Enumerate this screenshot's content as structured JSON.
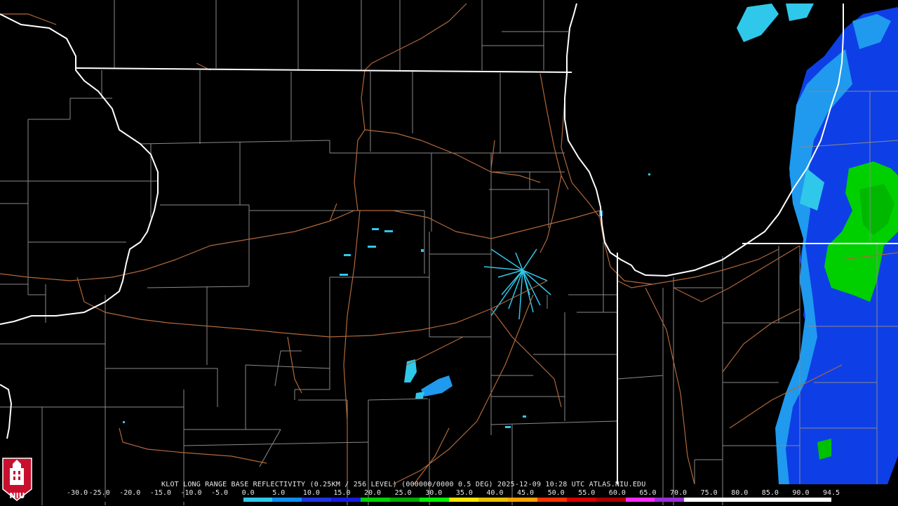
{
  "product_title": "KLOT LONG RANGE BASE REFLECTIVITY (0.25KM / 256 LEVEL) (000000/0000 0.5 DEG) 2025-12-09 10:28 UTC  ATLAS.NIU.EDU",
  "scale_labels": [
    "-30.0",
    "-25.0",
    "-20.0",
    "-15.0",
    "-10.0",
    "-5.0",
    "0.0",
    "5.0",
    "10.0",
    "15.0",
    "20.0",
    "25.0",
    "30.0",
    "35.0",
    "40.0",
    "45.0",
    "50.0",
    "55.0",
    "60.0",
    "65.0",
    "70.0",
    "75.0",
    "80.0",
    "85.0",
    "90.0",
    "94.5"
  ],
  "scale_colors": [
    "#000000",
    "#000000",
    "#000000",
    "#000000",
    "#000000",
    "#000000",
    "#2fc8ea",
    "#0b8ff2",
    "#1f35e6",
    "#1a1ae0",
    "#00d000",
    "#00a800",
    "#00f000",
    "#ffe600",
    "#e8c000",
    "#ffa000",
    "#ff3000",
    "#d80000",
    "#a80000",
    "#ff2aff",
    "#9a30d6",
    "#ffffff",
    "#ffffff",
    "#ffffff",
    "#ffffff",
    "#ffffff"
  ],
  "logo_text": "NIU",
  "colors": {
    "background": "#000000",
    "state_border": "#ffffff",
    "county_border": "#8a8a8a",
    "highway": "#b0683a"
  }
}
